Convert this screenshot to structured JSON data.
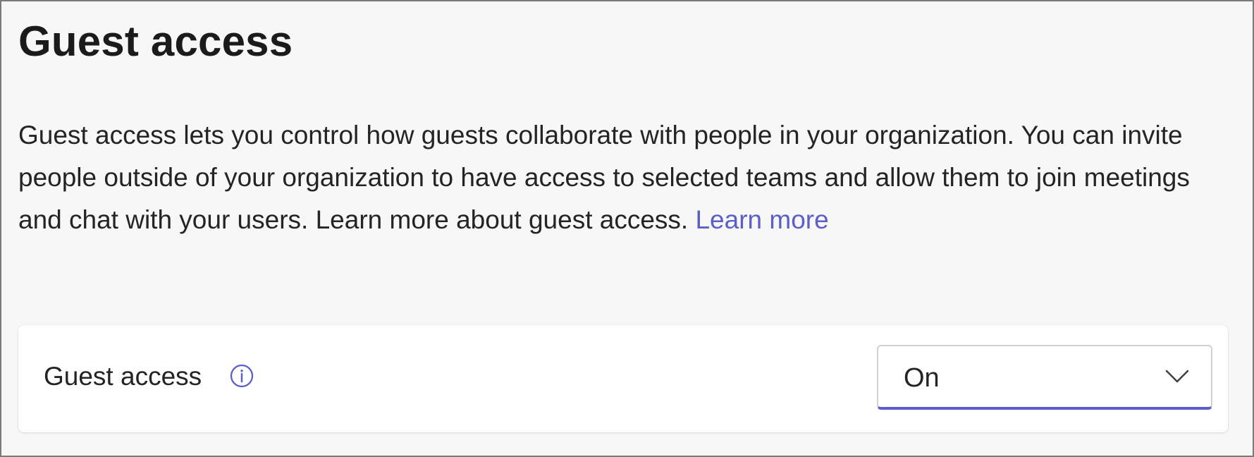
{
  "page": {
    "title": "Guest access",
    "description": "Guest access lets you control how guests collaborate with people in your organization. You can invite people outside of your organization to have access to selected teams and allow them to join meetings and chat with your users. Learn more about guest access.",
    "learn_more_label": "Learn more"
  },
  "setting": {
    "label": "Guest access",
    "info_icon": "info-icon",
    "value": "On",
    "dropdown_icon": "chevron-down-icon"
  },
  "colors": {
    "accent": "#5b5fc7",
    "text": "#242424",
    "background": "#f7f7f7",
    "card": "#ffffff"
  }
}
